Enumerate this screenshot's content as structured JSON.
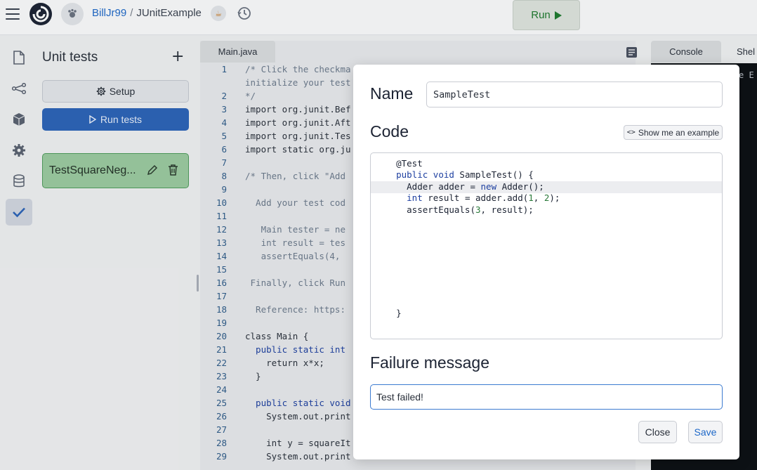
{
  "topbar": {
    "user": "BillJr99",
    "separator": "/",
    "repl_name": "JUnitExample",
    "run_label": "Run",
    "run_icon": "play-icon"
  },
  "rail": {
    "items": [
      {
        "icon": "file-icon"
      },
      {
        "icon": "share-graph-icon"
      },
      {
        "icon": "package-icon"
      },
      {
        "icon": "gear-icon"
      },
      {
        "icon": "database-icon"
      },
      {
        "icon": "checkmark-icon",
        "active": true
      }
    ]
  },
  "panel": {
    "title": "Unit tests",
    "add_label": "+",
    "setup_label": "Setup",
    "run_tests_label": "Run tests",
    "tests": [
      {
        "name": "TestSquareNegative",
        "display": "TestSquareNeg...",
        "status": "passed"
      }
    ]
  },
  "editor": {
    "tab": "Main.java",
    "lines": [
      {
        "n": "1",
        "text": "/* Click the checkma",
        "cls": "comment"
      },
      {
        "n": "",
        "text": "initialize your test",
        "cls": "comment"
      },
      {
        "n": "2",
        "text": "*/",
        "cls": "comment"
      },
      {
        "n": "3",
        "text": "import org.junit.Bef",
        "cls": ""
      },
      {
        "n": "4",
        "text": "import org.junit.Aft",
        "cls": ""
      },
      {
        "n": "5",
        "text": "import org.junit.Tes",
        "cls": ""
      },
      {
        "n": "6",
        "text": "import static org.ju",
        "cls": ""
      },
      {
        "n": "7",
        "text": "",
        "cls": ""
      },
      {
        "n": "8",
        "text": "/* Then, click \"Add ",
        "cls": "comment"
      },
      {
        "n": "9",
        "text": "",
        "cls": ""
      },
      {
        "n": "10",
        "text": "  Add your test cod",
        "cls": "comment"
      },
      {
        "n": "11",
        "text": "",
        "cls": ""
      },
      {
        "n": "12",
        "text": "   Main tester = ne",
        "cls": "comment"
      },
      {
        "n": "13",
        "text": "   int result = tes",
        "cls": "comment"
      },
      {
        "n": "14",
        "text": "   assertEquals(4, ",
        "cls": "comment"
      },
      {
        "n": "15",
        "text": "",
        "cls": ""
      },
      {
        "n": "16",
        "text": " Finally, click Run",
        "cls": "comment"
      },
      {
        "n": "17",
        "text": "",
        "cls": ""
      },
      {
        "n": "18",
        "text": "  Reference: https:",
        "cls": "comment"
      },
      {
        "n": "19",
        "text": "",
        "cls": ""
      },
      {
        "n": "20",
        "text": "class Main {",
        "cls": ""
      },
      {
        "n": "21",
        "text": "  public static int ",
        "cls": "kw"
      },
      {
        "n": "22",
        "text": "    return x*x;",
        "cls": ""
      },
      {
        "n": "23",
        "text": "  }",
        "cls": ""
      },
      {
        "n": "24",
        "text": "",
        "cls": ""
      },
      {
        "n": "25",
        "text": "  public static void",
        "cls": "kw"
      },
      {
        "n": "26",
        "text": "    System.out.print",
        "cls": ""
      },
      {
        "n": "27",
        "text": "",
        "cls": ""
      },
      {
        "n": "28",
        "text": "    int y = squareIt",
        "cls": ""
      },
      {
        "n": "29",
        "text": "    System.out.print",
        "cls": ""
      }
    ]
  },
  "right": {
    "console_tab": "Console",
    "shell_tab": "Shel",
    "console_text": "e E"
  },
  "modal": {
    "name_label": "Name",
    "name_value": "SampleTest",
    "code_label": "Code",
    "example_label": "Show me an example",
    "code_lines": [
      "    @Test",
      "    public void SampleTest() {",
      "      Adder adder = new Adder();",
      "      int result = adder.add(1, 2);",
      "      assertEquals(3, result);",
      "",
      "",
      "",
      "",
      "",
      "",
      "",
      "",
      "    }"
    ],
    "failure_label": "Failure message",
    "failure_value": "Test failed!",
    "close_label": "Close",
    "save_label": "Save"
  }
}
